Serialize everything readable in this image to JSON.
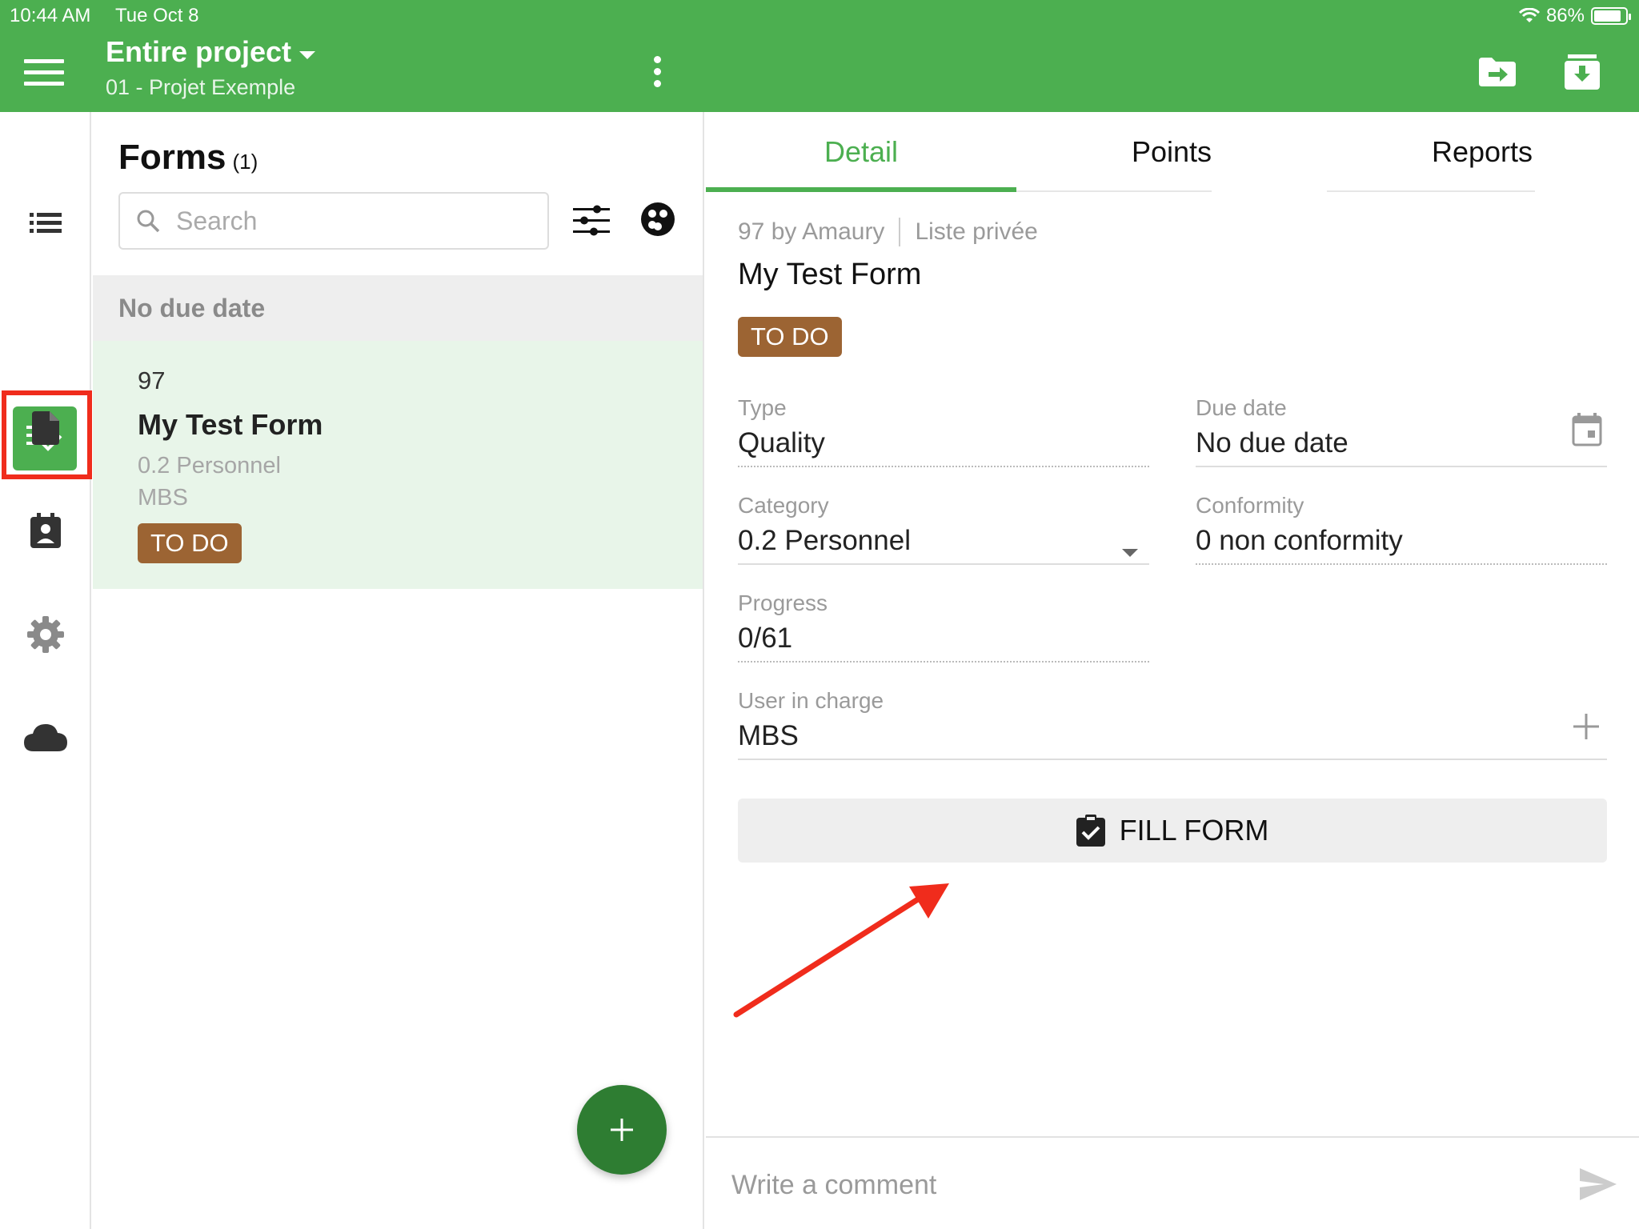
{
  "status_bar": {
    "time": "10:44 AM",
    "date": "Tue Oct 8",
    "battery": "86%",
    "battery_level": 0.86
  },
  "header": {
    "title": "Entire project",
    "subtitle": "01 - Projet Exemple"
  },
  "sidebar": {
    "items": [
      {
        "icon": "list-icon"
      },
      {
        "icon": "checklist-icon",
        "active": true
      },
      {
        "icon": "document-icon"
      },
      {
        "icon": "contact-calendar-icon"
      },
      {
        "icon": "gear-icon"
      },
      {
        "icon": "cloud-icon"
      }
    ]
  },
  "forms_list": {
    "title": "Forms",
    "count": "(1)",
    "search_placeholder": "Search",
    "section": "No due date",
    "items": [
      {
        "number": "97",
        "title": "My Test Form",
        "category": "0.2 Personnel",
        "user": "MBS",
        "status": "TO DO"
      }
    ]
  },
  "detail": {
    "tabs": [
      {
        "label": "Detail"
      },
      {
        "label": "Points"
      },
      {
        "label": "Reports"
      }
    ],
    "meta_author": "97 by Amaury",
    "meta_list": "Liste privée",
    "title": "My Test Form",
    "status": "TO DO",
    "fields": {
      "type": {
        "label": "Type",
        "value": "Quality"
      },
      "due_date": {
        "label": "Due date",
        "value": "No due date"
      },
      "category": {
        "label": "Category",
        "value": "0.2 Personnel"
      },
      "conformity": {
        "label": "Conformity",
        "value": "0 non conformity"
      },
      "progress": {
        "label": "Progress",
        "value": "0/61"
      },
      "user_in_charge": {
        "label": "User in charge",
        "value": "MBS"
      }
    },
    "fill_button": "FILL FORM",
    "comment_placeholder": "Write a comment"
  },
  "colors": {
    "primary": "#4caf50",
    "fab": "#2e7d32",
    "status_todo": "#9c6433",
    "highlight": "#f02c1c"
  }
}
